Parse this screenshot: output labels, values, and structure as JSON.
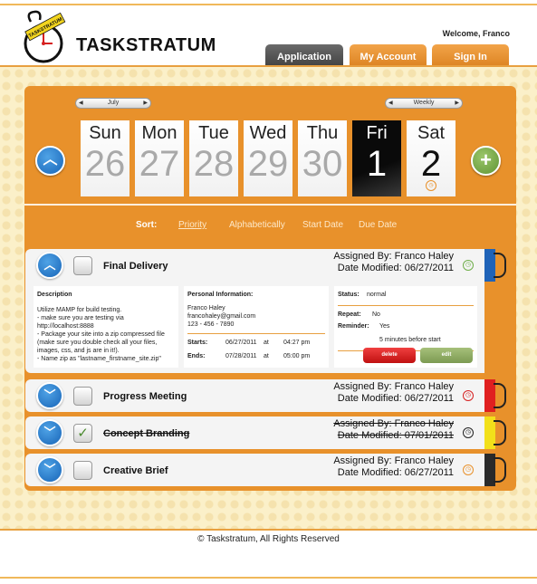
{
  "header": {
    "brand": "TASKSTRATUM",
    "logo_text": "TASKSTRATUM",
    "welcome": "Welcome, Franco",
    "nav": {
      "application": "Application",
      "account": "My Account",
      "signin": "Sign In"
    },
    "colors": {
      "accent": "#e8912b",
      "active_tab": "#4a4a4a"
    }
  },
  "calendar": {
    "month": "July",
    "view": "Weekly",
    "days": [
      {
        "name": "Sun",
        "date": "26"
      },
      {
        "name": "Mon",
        "date": "27"
      },
      {
        "name": "Tue",
        "date": "28"
      },
      {
        "name": "Wed",
        "date": "29"
      },
      {
        "name": "Thu",
        "date": "30"
      },
      {
        "name": "Fri",
        "date": "1"
      },
      {
        "name": "Sat",
        "date": "2"
      }
    ],
    "up_icon": "chevron-up-icon",
    "add_icon": "plus-icon"
  },
  "sort": {
    "label": "Sort:",
    "priority": "Priority",
    "alpha": "Alphabetically",
    "start": "Start Date",
    "due": "Due Date"
  },
  "tasks": [
    {
      "title": "Final Delivery",
      "assigned": "Assigned By: Franco Haley",
      "modified": "Date Modified: 06/27/2011",
      "tab_color": "#1f63b8",
      "details": {
        "desc_title": "Description",
        "desc_lines": [
          "Utilize MAMP for build testing.",
          "- make sure you are testing via",
          "  http://localhost:8888",
          "- Package your site into a zip compressed file",
          "  (make sure you double check all your files,",
          "  images, css, and js are in it!).",
          "- Name zip as \"lastname_firstname_site.zip\""
        ],
        "personal_title": "Personal Information:",
        "name": "Franco Haley",
        "email": "francohaley@gmail.com",
        "phone": "123 - 456 - 7890",
        "starts_label": "Starts:",
        "starts_date": "06/27/2011",
        "starts_at": "at",
        "starts_time": "04:27 pm",
        "ends_label": "Ends:",
        "ends_date": "07/28/2011",
        "ends_at": "at",
        "ends_time": "05:00 pm",
        "status_label": "Status:",
        "status": "normal",
        "repeat_label": "Repeat:",
        "repeat": "No",
        "reminder_label": "Reminder:",
        "reminder": "Yes",
        "reminder_when": "5 minutes before start",
        "delete": "delete",
        "edit": "edit"
      }
    },
    {
      "title": "Progress Meeting",
      "assigned": "Assigned By:  Franco Haley",
      "modified": "Date Modified: 06/27/2011",
      "tab_color": "#e02020"
    },
    {
      "title": "Concept Branding",
      "assigned": "Assigned By:  Franco Haley",
      "modified": "Date Modified: 07/01/2011",
      "tab_color": "#f2e01a",
      "completed": true
    },
    {
      "title": "Creative Brief",
      "assigned": "Assigned By:  Franco Haley",
      "modified": "Date Modified: 06/27/2011",
      "tab_color": "#2a2a2a"
    }
  ],
  "footer": "© Taskstratum, All Rights Reserved"
}
